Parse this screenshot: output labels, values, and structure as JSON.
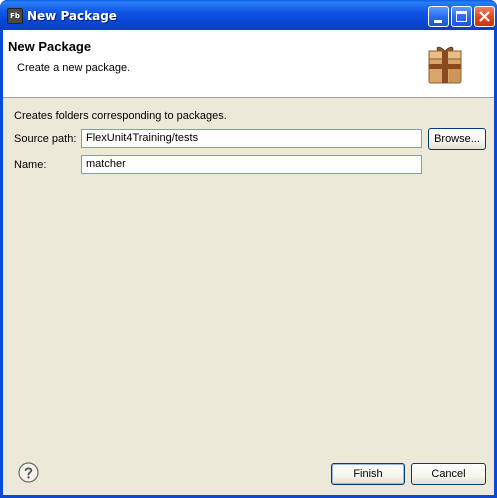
{
  "window": {
    "title": "New Package",
    "app_icon_text": "Fb"
  },
  "header": {
    "title": "New Package",
    "description": "Create a new package."
  },
  "content": {
    "description": "Creates folders corresponding to packages.",
    "source_path": {
      "label": "Source path:",
      "value": "FlexUnit4Training/tests",
      "browse_label": "Browse..."
    },
    "name": {
      "label": "Name:",
      "value": "matcher"
    }
  },
  "footer": {
    "finish_label": "Finish",
    "cancel_label": "Cancel"
  },
  "icons": {
    "app": "flash-builder-icon",
    "minimize": "minimize-icon",
    "maximize": "maximize-icon",
    "close": "close-icon",
    "wizard_banner": "package-icon",
    "help": "help-icon"
  },
  "colors": {
    "titlebar": "#0a48d6",
    "dialog_bg": "#ece9d8",
    "header_bg": "#ffffff",
    "input_border": "#7f9db9",
    "button_border": "#003c74"
  }
}
